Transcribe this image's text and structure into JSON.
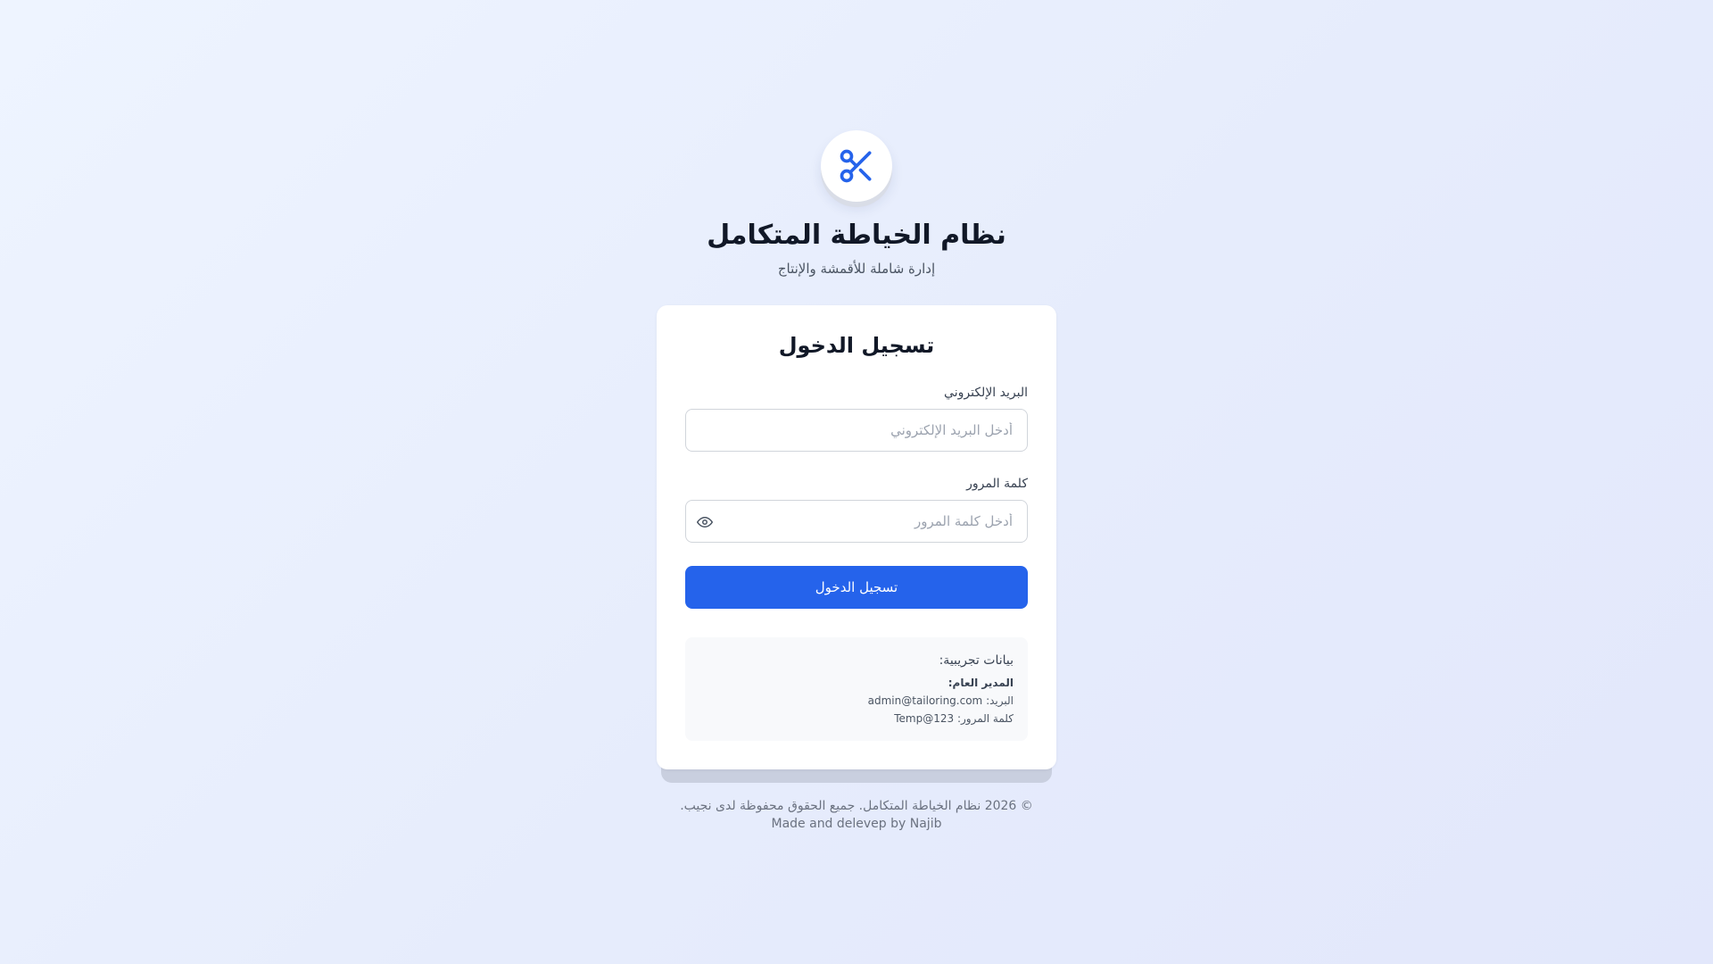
{
  "brand": {
    "logo_icon": "scissors-icon",
    "title": "نظام الخياطة المتكامل",
    "subtitle": "إدارة شاملة للأقمشة والإنتاج"
  },
  "login": {
    "title": "تسجيل الدخول",
    "email_label": "البريد الإلكتروني",
    "email_placeholder": "أدخل البريد الإلكتروني",
    "email_value": "",
    "password_label": "كلمة المرور",
    "password_placeholder": "أدخل كلمة المرور",
    "password_value": "",
    "password_toggle_icon": "eye-icon",
    "submit_label": "تسجيل الدخول"
  },
  "demo": {
    "title": "بيانات تجريبية:",
    "role": "المدير العام:",
    "email_label": "البريد:",
    "email_value": "admin@tailoring.com",
    "password_label": "كلمة المرور:",
    "password_value": "Temp@123"
  },
  "footer": {
    "copyright": "© 2026 نظام الخياطة المتكامل. جميع الحقوق محفوظة لدى نجيب.",
    "credit": "Made and delevep by Najib"
  },
  "colors": {
    "primary": "#2563eb",
    "logo_icon": "#2563eb",
    "background_start": "#eef4ff",
    "background_end": "#e2e7fb"
  }
}
